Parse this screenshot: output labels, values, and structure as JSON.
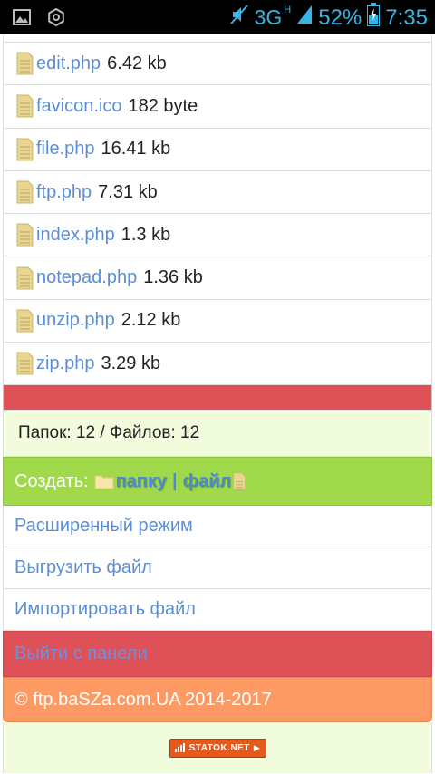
{
  "status_bar": {
    "network": "3G",
    "network_sub": "H",
    "battery": "52%",
    "time": "7:35"
  },
  "files": [
    {
      "name": "edit.php",
      "size": "6.42 kb"
    },
    {
      "name": "favicon.ico",
      "size": "182 byte"
    },
    {
      "name": "file.php",
      "size": "16.41 kb"
    },
    {
      "name": "ftp.php",
      "size": "7.31 kb"
    },
    {
      "name": "index.php",
      "size": "1.3 kb"
    },
    {
      "name": "notepad.php",
      "size": "1.36 kb"
    },
    {
      "name": "unzip.php",
      "size": "2.12 kb"
    },
    {
      "name": "zip.php",
      "size": "3.29 kb"
    }
  ],
  "summary": "Папок: 12 / Файлов: 12",
  "create": {
    "label": "Создать:",
    "folder_link": "папку",
    "separator": "|",
    "file_link": "файл"
  },
  "menu": {
    "advanced": "Расширенный режим",
    "upload": "Выгрузить файл",
    "import": "Импортировать файл",
    "logout": "Выйти с панели"
  },
  "footer": "© ftp.baSZa.com.UA 2014-2017",
  "counter_badge": "STATOK.NET"
}
